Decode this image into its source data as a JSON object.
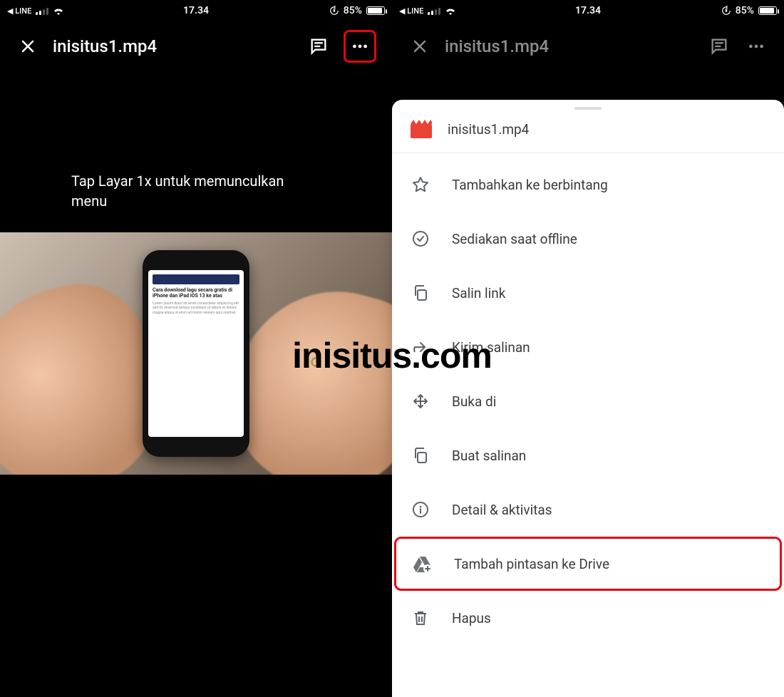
{
  "status": {
    "back_app": "LINE",
    "time": "17.34",
    "battery_pct": "85%"
  },
  "left": {
    "file_title": "inisitus1.mp4",
    "instruction": "Tap Layar 1x untuk memunculkan menu",
    "phone_headline": "Cara download lagu secara gratis di iPhone dan iPad iOS 13 ke atas"
  },
  "right": {
    "file_title": "inisitus1.mp4",
    "sheet_filename": "inisitus1.mp4",
    "menu": {
      "star": "Tambahkan ke berbintang",
      "offline": "Sediakan saat offline",
      "copylink": "Salin link",
      "send": "Kirim salinan",
      "openin": "Buka di",
      "duplicate": "Buat salinan",
      "details": "Detail & aktivitas",
      "shortcut": "Tambah pintasan ke Drive",
      "delete": "Hapus"
    }
  },
  "watermark": "inisitus.com"
}
